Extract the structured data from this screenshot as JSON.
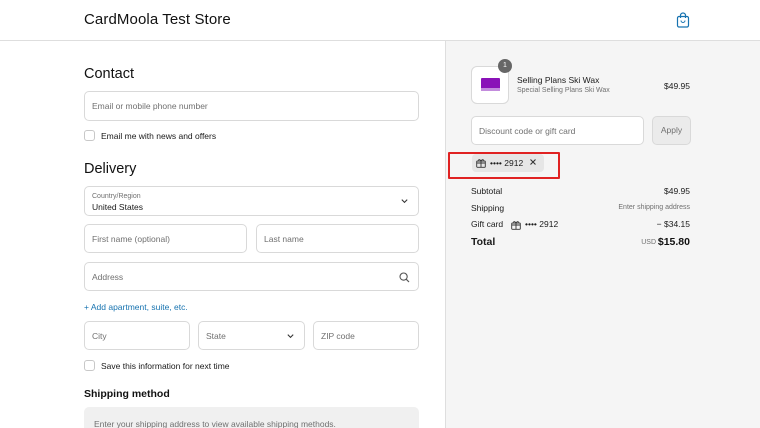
{
  "header": {
    "store_name": "CardMoola Test Store",
    "bag_icon": "shopping-bag-icon"
  },
  "contact": {
    "title": "Contact",
    "email_placeholder": "Email or mobile phone number",
    "email_offers_label": "Email me with news and offers"
  },
  "delivery": {
    "title": "Delivery",
    "country_label": "Country/Region",
    "country_value": "United States",
    "first_name_placeholder": "First name (optional)",
    "last_name_placeholder": "Last name",
    "address_placeholder": "Address",
    "add_apartment_link": "+ Add apartment, suite, etc.",
    "city_placeholder": "City",
    "state_placeholder": "State",
    "zip_placeholder": "ZIP code",
    "save_info_label": "Save this information for next time"
  },
  "shipping_method": {
    "title": "Shipping method",
    "message": "Enter your shipping address to view available shipping methods."
  },
  "summary": {
    "product": {
      "quantity": "1",
      "name": "Selling Plans Ski Wax",
      "variant": "Special Selling Plans Ski Wax",
      "price": "$49.95"
    },
    "discount_placeholder": "Discount code or gift card",
    "apply_label": "Apply",
    "gift_card_tag": "•••• 2912",
    "subtotal_label": "Subtotal",
    "subtotal_value": "$49.95",
    "shipping_label": "Shipping",
    "shipping_value": "Enter shipping address",
    "gift_card_label": "Gift card",
    "gift_card_code": "•••• 2912",
    "gift_card_value": "− $34.15",
    "total_label": "Total",
    "currency": "USD",
    "total_value": "$15.80"
  },
  "colors": {
    "link": "#1773b0",
    "highlight": "#e02222",
    "product": "#8a12b8"
  }
}
